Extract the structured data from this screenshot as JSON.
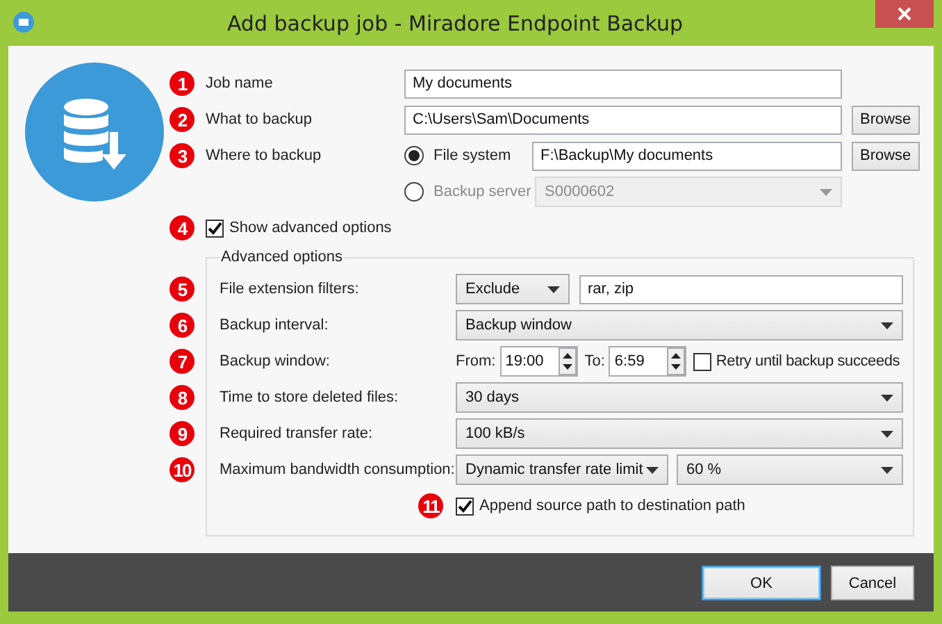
{
  "window": {
    "title": "Add backup job - Miradore Endpoint Backup"
  },
  "basic": {
    "job_name": {
      "number": "1",
      "label": "Job name",
      "value": "My documents"
    },
    "what_to_backup": {
      "number": "2",
      "label": "What to backup",
      "value": "C:\\Users\\Sam\\Documents",
      "button": "Browse"
    },
    "where_to_backup": {
      "number": "3",
      "label": "Where to backup",
      "options": [
        {
          "kind": "path",
          "label": "File system",
          "selected": true,
          "value": "F:\\Backup\\My documents",
          "button": "Browse"
        },
        {
          "kind": "combo",
          "label": "Backup server",
          "selected": false,
          "value": "S0000602",
          "disabled": true
        }
      ]
    },
    "show_advanced": {
      "number": "4",
      "label": "Show advanced options",
      "checked": true
    }
  },
  "advanced": {
    "title": "Advanced options",
    "rows": [
      {
        "kind": "combo_text",
        "number": "5",
        "label": "File extension filters:",
        "combo": "Exclude",
        "value": "rar, zip"
      },
      {
        "kind": "combo",
        "number": "6",
        "label": "Backup interval:",
        "value": "Backup window"
      },
      {
        "kind": "time_window",
        "number": "7",
        "label": "Backup window:",
        "from_label": "From:",
        "from": "19:00",
        "to_label": "To:",
        "to": "6:59",
        "retry": {
          "label": "Retry until backup succeeds",
          "checked": false
        }
      },
      {
        "kind": "combo",
        "number": "8",
        "label": "Time to store deleted files:",
        "value": "30 days"
      },
      {
        "kind": "combo",
        "number": "9",
        "label": "Required transfer rate:",
        "value": "100 kB/s"
      },
      {
        "kind": "two_combos",
        "number": "10",
        "label": "Maximum bandwidth consumption:",
        "combo": "Dynamic transfer rate limit",
        "value": "60 %"
      }
    ],
    "append": {
      "number": "11",
      "label": "Append source path to destination path",
      "checked": true
    }
  },
  "buttons": [
    {
      "label": "OK",
      "default": true
    },
    {
      "label": "Cancel",
      "default": false
    }
  ]
}
